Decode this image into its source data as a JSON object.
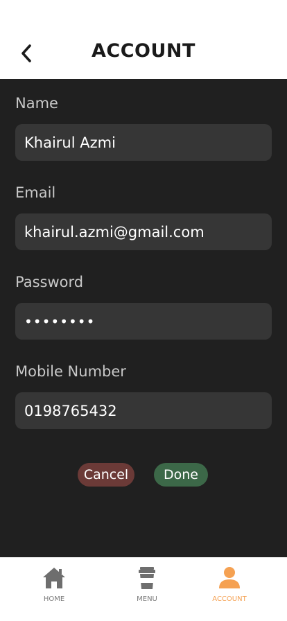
{
  "header": {
    "title": "ACCOUNT",
    "back_icon": "chevron-left-icon"
  },
  "form": {
    "name": {
      "label": "Name",
      "value": "Khairul Azmi"
    },
    "email": {
      "label": "Email",
      "value": "khairul.azmi@gmail.com"
    },
    "password": {
      "label": "Password",
      "value": "••••••••"
    },
    "mobile": {
      "label": "Mobile Number",
      "value": "0198765432"
    }
  },
  "actions": {
    "cancel_label": "Cancel",
    "done_label": "Done",
    "cancel_color": "#6b3a37",
    "done_color": "#3c6848"
  },
  "tabbar": {
    "items": [
      {
        "label": "HOME",
        "icon": "home-icon",
        "active": false
      },
      {
        "label": "MENU",
        "icon": "coffee-cup-icon",
        "active": false
      },
      {
        "label": "ACCOUNT",
        "icon": "user-icon",
        "active": true
      }
    ],
    "active_color": "#f5a152",
    "inactive_color": "#7a7a7a"
  }
}
